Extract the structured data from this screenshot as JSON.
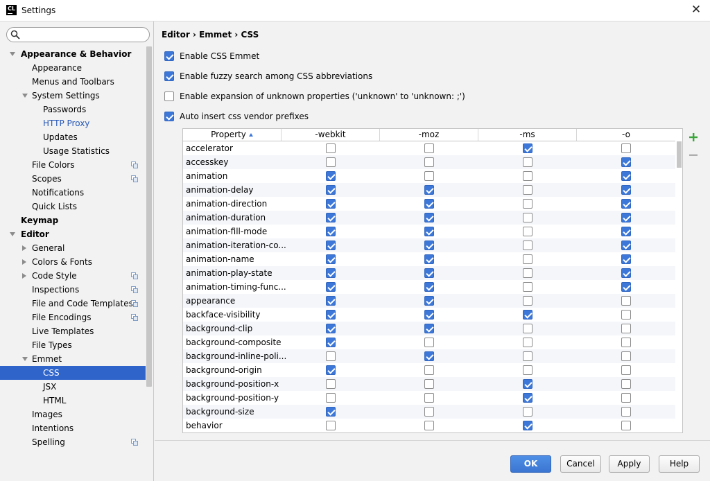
{
  "window": {
    "title": "Settings",
    "app_icon": "CL"
  },
  "search": {
    "placeholder": ""
  },
  "sidebar": {
    "items": [
      {
        "label": "Appearance & Behavior",
        "level": 0,
        "bold": true,
        "arrow": "down"
      },
      {
        "label": "Appearance",
        "level": 1
      },
      {
        "label": "Menus and Toolbars",
        "level": 1
      },
      {
        "label": "System Settings",
        "level": 1,
        "arrow": "down"
      },
      {
        "label": "Passwords",
        "level": 2
      },
      {
        "label": "HTTP Proxy",
        "level": 2,
        "link": true
      },
      {
        "label": "Updates",
        "level": 2
      },
      {
        "label": "Usage Statistics",
        "level": 2
      },
      {
        "label": "File Colors",
        "level": 1,
        "copy": true
      },
      {
        "label": "Scopes",
        "level": 1,
        "copy": true
      },
      {
        "label": "Notifications",
        "level": 1
      },
      {
        "label": "Quick Lists",
        "level": 1
      },
      {
        "label": "Keymap",
        "level": 0,
        "bold": true
      },
      {
        "label": "Editor",
        "level": 0,
        "bold": true,
        "arrow": "down"
      },
      {
        "label": "General",
        "level": 1,
        "arrow": "right"
      },
      {
        "label": "Colors & Fonts",
        "level": 1,
        "arrow": "right"
      },
      {
        "label": "Code Style",
        "level": 1,
        "arrow": "right",
        "copy": true
      },
      {
        "label": "Inspections",
        "level": 1,
        "copy": true
      },
      {
        "label": "File and Code Templates",
        "level": 1,
        "copy": true
      },
      {
        "label": "File Encodings",
        "level": 1,
        "copy": true
      },
      {
        "label": "Live Templates",
        "level": 1
      },
      {
        "label": "File Types",
        "level": 1
      },
      {
        "label": "Emmet",
        "level": 1,
        "arrow": "down"
      },
      {
        "label": "CSS",
        "level": 2,
        "selected": true
      },
      {
        "label": "JSX",
        "level": 2
      },
      {
        "label": "HTML",
        "level": 2
      },
      {
        "label": "Images",
        "level": 1
      },
      {
        "label": "Intentions",
        "level": 1
      },
      {
        "label": "Spelling",
        "level": 1,
        "copy": true
      }
    ]
  },
  "breadcrumb": "Editor › Emmet › CSS",
  "options": [
    {
      "label": "Enable CSS Emmet",
      "checked": true
    },
    {
      "label": "Enable fuzzy search among CSS abbreviations",
      "checked": true
    },
    {
      "label": "Enable expansion of unknown properties ('unknown' to 'unknown: ;')",
      "checked": false
    },
    {
      "label": "Auto insert css vendor prefixes",
      "checked": true
    }
  ],
  "table": {
    "columns": [
      "Property",
      "-webkit",
      "-moz",
      "-ms",
      "-o"
    ],
    "rows": [
      {
        "name": "accelerator",
        "checks": [
          false,
          false,
          true,
          false
        ]
      },
      {
        "name": "accesskey",
        "checks": [
          false,
          false,
          false,
          true
        ]
      },
      {
        "name": "animation",
        "checks": [
          true,
          false,
          false,
          true
        ]
      },
      {
        "name": "animation-delay",
        "checks": [
          true,
          true,
          false,
          true
        ]
      },
      {
        "name": "animation-direction",
        "checks": [
          true,
          true,
          false,
          true
        ]
      },
      {
        "name": "animation-duration",
        "checks": [
          true,
          true,
          false,
          true
        ]
      },
      {
        "name": "animation-fill-mode",
        "checks": [
          true,
          true,
          false,
          true
        ]
      },
      {
        "name": "animation-iteration-co...",
        "checks": [
          true,
          true,
          false,
          true
        ]
      },
      {
        "name": "animation-name",
        "checks": [
          true,
          true,
          false,
          true
        ]
      },
      {
        "name": "animation-play-state",
        "checks": [
          true,
          true,
          false,
          true
        ]
      },
      {
        "name": "animation-timing-func...",
        "checks": [
          true,
          true,
          false,
          true
        ]
      },
      {
        "name": "appearance",
        "checks": [
          true,
          true,
          false,
          false
        ]
      },
      {
        "name": "backface-visibility",
        "checks": [
          true,
          true,
          true,
          false
        ]
      },
      {
        "name": "background-clip",
        "checks": [
          true,
          true,
          false,
          false
        ]
      },
      {
        "name": "background-composite",
        "checks": [
          true,
          false,
          false,
          false
        ]
      },
      {
        "name": "background-inline-poli...",
        "checks": [
          false,
          true,
          false,
          false
        ]
      },
      {
        "name": "background-origin",
        "checks": [
          true,
          false,
          false,
          false
        ]
      },
      {
        "name": "background-position-x",
        "checks": [
          false,
          false,
          true,
          false
        ]
      },
      {
        "name": "background-position-y",
        "checks": [
          false,
          false,
          true,
          false
        ]
      },
      {
        "name": "background-size",
        "checks": [
          true,
          false,
          false,
          false
        ]
      },
      {
        "name": "behavior",
        "checks": [
          false,
          false,
          true,
          false
        ]
      }
    ]
  },
  "buttons": {
    "ok": "OK",
    "cancel": "Cancel",
    "apply": "Apply",
    "help": "Help"
  },
  "colors": {
    "accent": "#3d78d8",
    "selection": "#2f65ca",
    "link": "#2557b7",
    "add": "#3aa53a"
  },
  "icons": {
    "search": "search-icon",
    "close": "close-icon",
    "add": "plus-icon",
    "remove": "minus-icon",
    "copy": "copy-settings-icon"
  }
}
